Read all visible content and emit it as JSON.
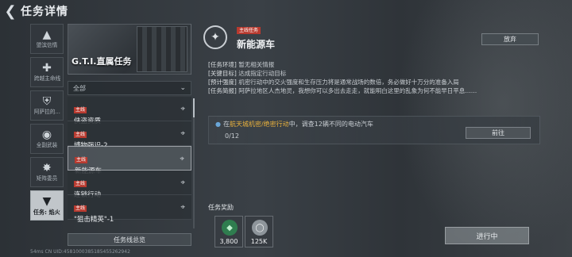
{
  "header": {
    "back_icon": "chevron-left-icon",
    "title": "任务详情"
  },
  "sidebar": {
    "items": [
      {
        "icon": "triangle-logo-icon",
        "label": "盟滨信情",
        "active": false
      },
      {
        "icon": "cross-icon",
        "label": "跨越主命线",
        "active": false
      },
      {
        "icon": "shield-icon",
        "label": "阿萨拉的...",
        "active": false
      },
      {
        "icon": "circle-icon",
        "label": "全副武装",
        "active": false
      },
      {
        "icon": "star-icon",
        "label": "矩阵委员",
        "active": false
      },
      {
        "icon": "v-logo-icon",
        "label": "任务: 焰火",
        "active": true
      }
    ]
  },
  "mission_list": {
    "banner_title": "G.T.I.直属任务",
    "filter_label": "全部",
    "items": [
      {
        "tag": "主线",
        "name": "侠盗资质",
        "selected": false
      },
      {
        "tag": "主线",
        "name": "博物强识-2",
        "selected": false
      },
      {
        "tag": "主线",
        "name": "新能源车",
        "selected": true
      },
      {
        "tag": "主线",
        "name": "连锁行动",
        "selected": false
      },
      {
        "tag": "主线",
        "name": "\"狙击精英\"-1",
        "selected": false
      }
    ],
    "overview_label": "任务线总览"
  },
  "detail": {
    "tag": "主线任务",
    "name": "新能源车",
    "abandon_label": "放弃",
    "info": [
      {
        "key": "[任务环境]",
        "value": "暂无相关情报"
      },
      {
        "key": "[关键目标]",
        "value": "达成指定行动目标"
      },
      {
        "key": "[预计强度]",
        "value": "机密行动中的交火强度和生存压力将是通常战场的数倍，务必做好十万分的准备入局"
      },
      {
        "key": "[任务简报]",
        "value": "阿萨拉地区人杰地灵，我想你可以多出去走走，就能明白这里的乱象为何不能早日平息……"
      }
    ],
    "objective": {
      "prefix": "在",
      "highlight": "航天城机密/绝密行动",
      "suffix": "中，调查12辆不同的电动汽车",
      "progress": "0/12"
    },
    "goto_label": "前往",
    "rewards_label": "任务奖励",
    "rewards": [
      {
        "icon": "green-badge-icon",
        "value": "3,800",
        "color": "#3fae6a"
      },
      {
        "icon": "silver-coin-icon",
        "value": "125K",
        "color": "#b9bec3"
      }
    ],
    "status_label": "进行中"
  },
  "footer": {
    "text": "54ms    CN UID:4581000385185455262942"
  }
}
